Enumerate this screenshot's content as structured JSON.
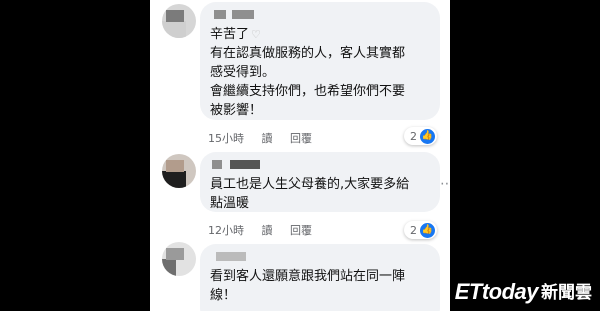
{
  "comments": [
    {
      "lines": [
        "辛苦了",
        "有在認真做服務的人，客人其實都",
        "感受得到。",
        "會繼續支持你們，也希望你們不要",
        "被影響！"
      ],
      "time": "15小時",
      "read": "讀",
      "reply": "回覆",
      "likes": "2"
    },
    {
      "lines": [
        "員工也是人生父母養的,大家要多給",
        "點溫暖"
      ],
      "time": "12小時",
      "read": "讀",
      "reply": "回覆",
      "likes": "2"
    },
    {
      "lines": [
        "看到客人還願意跟我們站在同一陣",
        "線！"
      ]
    }
  ],
  "more_icon": "⋯",
  "watermark": {
    "brand": "ETtoday",
    "news": "新聞雲"
  },
  "icons": {
    "like": "thumbs-up-icon",
    "heart": "heart-icon",
    "more": "more-options-icon"
  },
  "colors": {
    "like_blue": "#1877f2",
    "bubble": "#f0f2f5",
    "meta_text": "#65676b"
  }
}
